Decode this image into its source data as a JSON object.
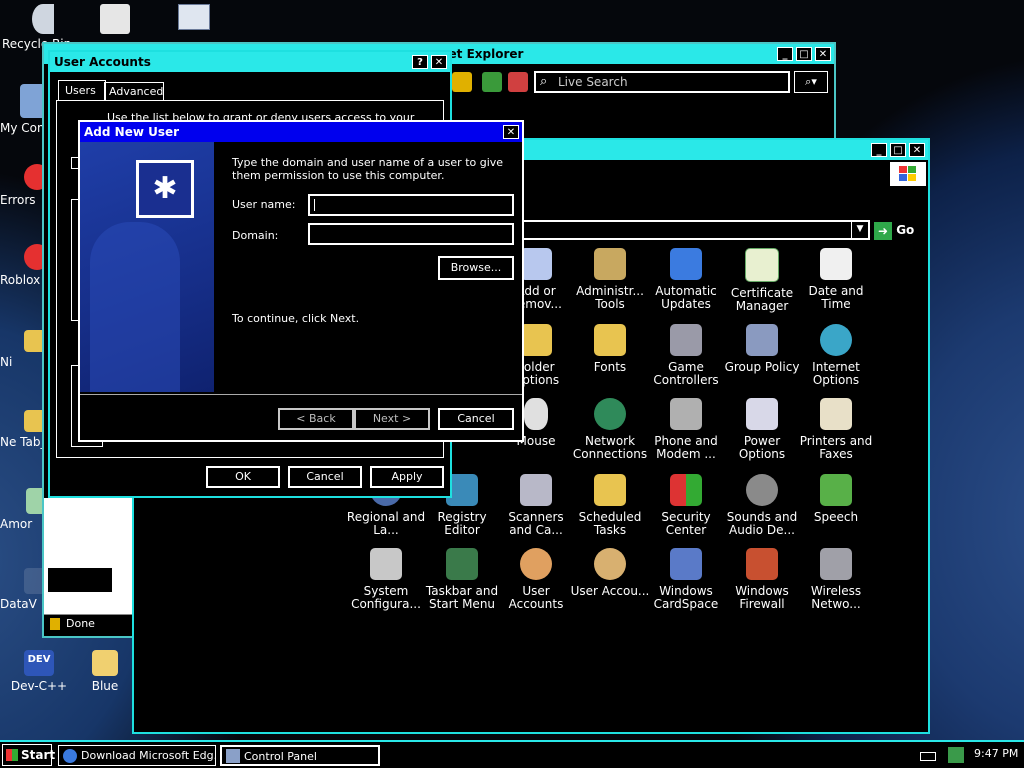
{
  "desktop": {
    "icons": [
      {
        "label": "Recycle Bin"
      },
      {
        "label": "My Computer"
      },
      {
        "label": "Errors"
      },
      {
        "label": "Roblox"
      },
      {
        "label": "Ni"
      },
      {
        "label": "Ne Tab_"
      },
      {
        "label": "Amor"
      },
      {
        "label": "DataV"
      },
      {
        "label": "Dev-C++"
      },
      {
        "label": "Blue"
      }
    ]
  },
  "ie_window": {
    "title": "Windows Internet Explorer",
    "title_visible": "net Explorer",
    "search_placeholder": "Live Search",
    "status": "Done"
  },
  "control_panel": {
    "title": "Control Panel",
    "go_label": "Go",
    "items": [
      {
        "label": "Add or Remov..."
      },
      {
        "label": "Administr... Tools"
      },
      {
        "label": "Automatic Updates"
      },
      {
        "label": "Certificate Manager"
      },
      {
        "label": "Date and Time"
      },
      {
        "label": "Folder Options"
      },
      {
        "label": "Fonts"
      },
      {
        "label": "Game Controllers"
      },
      {
        "label": "Group Policy"
      },
      {
        "label": "Internet Options"
      },
      {
        "label": "Mouse"
      },
      {
        "label": "Network Connections"
      },
      {
        "label": "Phone and Modem ..."
      },
      {
        "label": "Power Options"
      },
      {
        "label": "Printers and Faxes"
      },
      {
        "label": "Regional and La..."
      },
      {
        "label": "Registry Editor"
      },
      {
        "label": "Scanners and Ca..."
      },
      {
        "label": "Scheduled Tasks"
      },
      {
        "label": "Security Center"
      },
      {
        "label": "Sounds and Audio De..."
      },
      {
        "label": "Speech"
      },
      {
        "label": "System Configura..."
      },
      {
        "label": "Taskbar and Start Menu"
      },
      {
        "label": "User Accounts"
      },
      {
        "label": "User Accou..."
      },
      {
        "label": "Windows CardSpace"
      },
      {
        "label": "Windows Firewall"
      },
      {
        "label": "Wireless Netwo..."
      }
    ]
  },
  "user_accounts": {
    "title": "User Accounts",
    "tabs": [
      "Users",
      "Advanced"
    ],
    "intro": "Use the list below to grant or deny users access to your",
    "ok": "OK",
    "cancel": "Cancel",
    "apply": "Apply"
  },
  "add_user": {
    "title": "Add New User",
    "instructions": "Type the domain and user name of a user to give them permission to use this computer.",
    "username_label": "User name:",
    "username_value": "",
    "domain_label": "Domain:",
    "domain_value": "",
    "browse": "Browse...",
    "continue_text": "To continue, click Next.",
    "back": "< Back",
    "next": "Next >",
    "cancel": "Cancel"
  },
  "taskbar": {
    "start": "Start",
    "tasks": [
      {
        "label": "Download Microsoft Edg..."
      },
      {
        "label": "Control Panel"
      }
    ],
    "clock": "9:47 PM"
  }
}
